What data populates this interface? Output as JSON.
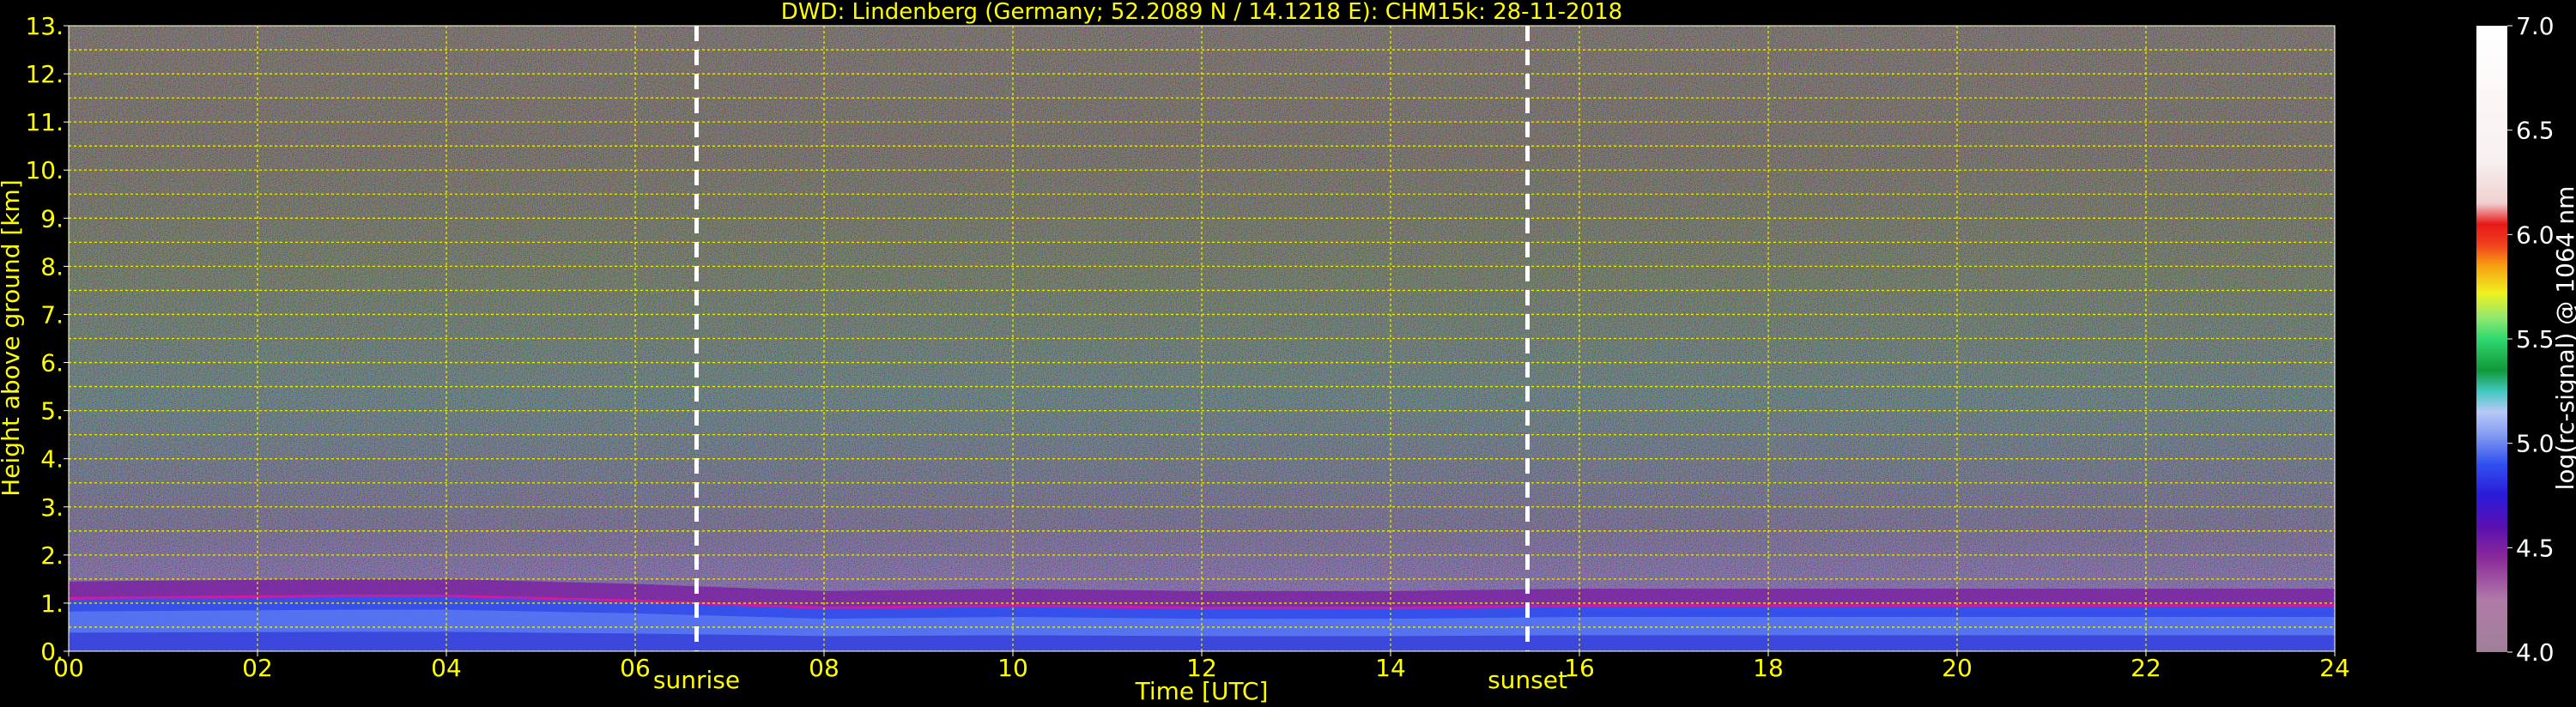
{
  "chart_data": {
    "type": "heatmap",
    "title": "DWD: Lindenberg (Germany; 52.2089 N / 14.1218 E):    CHM15k: 28-11-2018",
    "xlabel": "Time [UTC]",
    "ylabel": "Height above ground [km]",
    "xlim": [
      0,
      24
    ],
    "ylim": [
      0,
      13
    ],
    "x_ticks": [
      {
        "value": 0,
        "label": "00"
      },
      {
        "value": 2,
        "label": "02"
      },
      {
        "value": 4,
        "label": "04"
      },
      {
        "value": 6,
        "label": "06"
      },
      {
        "value": 8,
        "label": "08"
      },
      {
        "value": 10,
        "label": "10"
      },
      {
        "value": 12,
        "label": "12"
      },
      {
        "value": 14,
        "label": "14"
      },
      {
        "value": 16,
        "label": "16"
      },
      {
        "value": 18,
        "label": "18"
      },
      {
        "value": 20,
        "label": "20"
      },
      {
        "value": 22,
        "label": "22"
      },
      {
        "value": 24,
        "label": "24"
      }
    ],
    "y_ticks": [
      {
        "value": 0,
        "label": "0."
      },
      {
        "value": 1,
        "label": "1."
      },
      {
        "value": 2,
        "label": "2."
      },
      {
        "value": 3,
        "label": "3."
      },
      {
        "value": 4,
        "label": "4."
      },
      {
        "value": 5,
        "label": "5."
      },
      {
        "value": 6,
        "label": "6."
      },
      {
        "value": 7,
        "label": "7."
      },
      {
        "value": 8,
        "label": "8."
      },
      {
        "value": 9,
        "label": "9."
      },
      {
        "value": 10,
        "label": "10."
      },
      {
        "value": 11,
        "label": "11."
      },
      {
        "value": 12,
        "label": "12."
      },
      {
        "value": 13,
        "label": "13."
      }
    ],
    "grid": true,
    "events": [
      {
        "label": "sunrise",
        "time": 6.65
      },
      {
        "label": "sunset",
        "time": 15.45
      }
    ],
    "boundary_layer_top_km": [
      [
        0,
        1.1
      ],
      [
        2.9,
        1.15
      ],
      [
        4,
        1.15
      ],
      [
        6,
        1.05
      ],
      [
        8,
        0.9
      ],
      [
        10,
        0.95
      ],
      [
        12,
        0.9
      ],
      [
        14,
        0.9
      ],
      [
        16,
        0.95
      ],
      [
        18,
        0.95
      ],
      [
        20,
        0.95
      ],
      [
        22,
        0.95
      ],
      [
        24,
        0.95
      ]
    ],
    "colorbar": {
      "label": "log(rc-signal) @ 1064 nm",
      "range": [
        4.0,
        7.0
      ],
      "ticks": [
        {
          "value": 4.0,
          "label": "4.0"
        },
        {
          "value": 4.5,
          "label": "4.5"
        },
        {
          "value": 5.0,
          "label": "5.0"
        },
        {
          "value": 5.5,
          "label": "5.5"
        },
        {
          "value": 6.0,
          "label": "6.0"
        },
        {
          "value": 6.5,
          "label": "6.5"
        },
        {
          "value": 7.0,
          "label": "7.0"
        }
      ],
      "stops": [
        {
          "value": 4.0,
          "color": "#a08098"
        },
        {
          "value": 4.25,
          "color": "#b07aa8"
        },
        {
          "value": 4.45,
          "color": "#8a2a9a"
        },
        {
          "value": 4.6,
          "color": "#5a10b0"
        },
        {
          "value": 4.75,
          "color": "#2a1ad8"
        },
        {
          "value": 4.9,
          "color": "#3050f0"
        },
        {
          "value": 5.05,
          "color": "#8aa0f0"
        },
        {
          "value": 5.15,
          "color": "#b8c8f8"
        },
        {
          "value": 5.25,
          "color": "#40c8c0"
        },
        {
          "value": 5.35,
          "color": "#109838"
        },
        {
          "value": 5.5,
          "color": "#30d870"
        },
        {
          "value": 5.6,
          "color": "#90e870"
        },
        {
          "value": 5.72,
          "color": "#f0f020"
        },
        {
          "value": 5.85,
          "color": "#f8a010"
        },
        {
          "value": 5.95,
          "color": "#f04020"
        },
        {
          "value": 6.05,
          "color": "#e81818"
        },
        {
          "value": 6.15,
          "color": "#f0d0d0"
        },
        {
          "value": 6.35,
          "color": "#f8f0f0"
        },
        {
          "value": 7.0,
          "color": "#ffffff"
        }
      ]
    },
    "colors": {
      "background": "#000000",
      "text": "#ffff00",
      "grid": "#ffff00",
      "event_line": "#ffffff",
      "colorbar_text": "#ffffff"
    }
  }
}
